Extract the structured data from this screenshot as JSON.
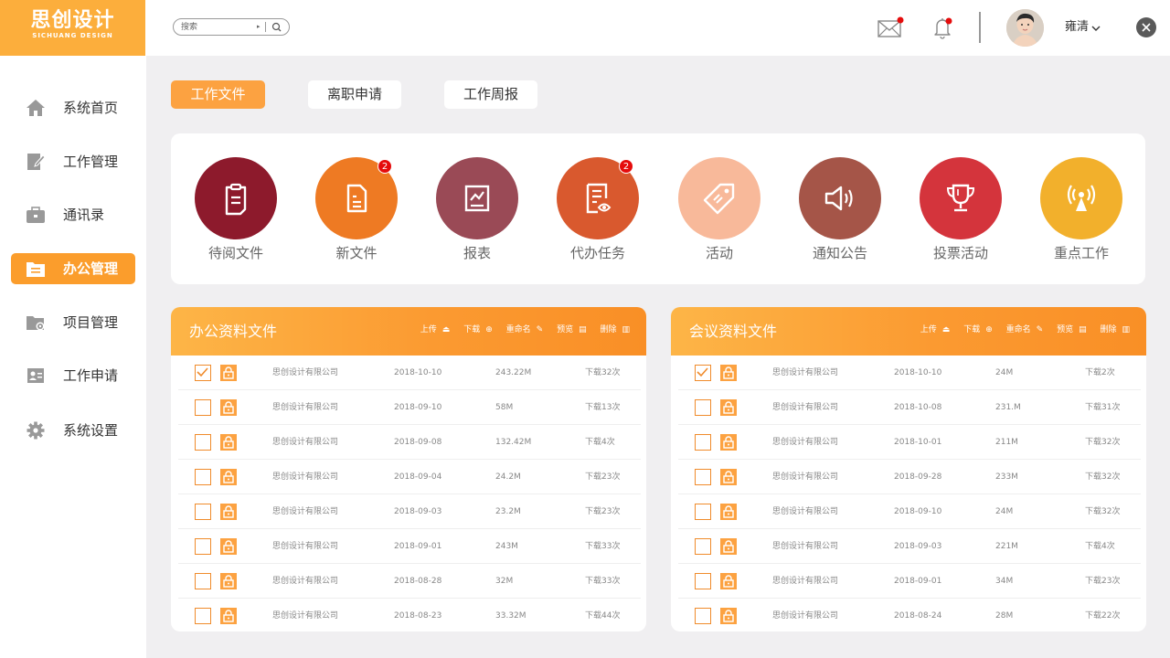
{
  "brand": {
    "name_cn": "思创设计",
    "name_en": "SICHUANG DESIGN"
  },
  "search": {
    "placeholder": "搜索"
  },
  "user": {
    "name": "雍清"
  },
  "colors": {
    "accent": "#fb9d2c",
    "brand": "#fcae3c",
    "badge": "#e50c0c"
  },
  "sidebar": {
    "items": [
      {
        "label": "系统首页",
        "icon": "home-icon"
      },
      {
        "label": "工作管理",
        "icon": "edit-document-icon"
      },
      {
        "label": "通讯录",
        "icon": "briefcase-icon"
      },
      {
        "label": "办公管理",
        "icon": "folder-icon",
        "active": true
      },
      {
        "label": "项目管理",
        "icon": "folder-settings-icon"
      },
      {
        "label": "工作申请",
        "icon": "id-card-icon"
      },
      {
        "label": "系统设置",
        "icon": "gear-icon"
      }
    ]
  },
  "tabs": [
    {
      "label": "工作文件",
      "active": true
    },
    {
      "label": "离职申请"
    },
    {
      "label": "工作周报"
    }
  ],
  "quick_actions": [
    {
      "label": "待阅文件",
      "color": "#8d1a2c",
      "icon": "clipboard-icon",
      "badge": ""
    },
    {
      "label": "新文件",
      "color": "#ee7a23",
      "icon": "new-file-icon",
      "badge": "2"
    },
    {
      "label": "报表",
      "color": "#9a4a56",
      "icon": "report-icon",
      "badge": ""
    },
    {
      "label": "代办任务",
      "color": "#d9592e",
      "icon": "task-list-icon",
      "badge": "2"
    },
    {
      "label": "活动",
      "color": "#f8b99a",
      "icon": "tag-icon",
      "badge": ""
    },
    {
      "label": "通知公告",
      "color": "#a55548",
      "icon": "speaker-icon",
      "badge": ""
    },
    {
      "label": "投票活动",
      "color": "#d4343c",
      "icon": "trophy-icon",
      "badge": ""
    },
    {
      "label": "重点工作",
      "color": "#f2b02c",
      "icon": "broadcast-icon",
      "badge": ""
    }
  ],
  "panels": [
    {
      "title": "办公资料文件",
      "actions": [
        "上传",
        "下载",
        "重命名",
        "预览",
        "删除"
      ],
      "rows": [
        {
          "checked": true,
          "company": "思创设计有限公司",
          "date": "2018-10-10",
          "size": "243.22M",
          "downloads": "下载32次"
        },
        {
          "checked": false,
          "company": "思创设计有限公司",
          "date": "2018-09-10",
          "size": "58M",
          "downloads": "下载13次"
        },
        {
          "checked": false,
          "company": "思创设计有限公司",
          "date": "2018-09-08",
          "size": "132.42M",
          "downloads": "下载4次"
        },
        {
          "checked": false,
          "company": "思创设计有限公司",
          "date": "2018-09-04",
          "size": "24.2M",
          "downloads": "下载23次"
        },
        {
          "checked": false,
          "company": "思创设计有限公司",
          "date": "2018-09-03",
          "size": "23.2M",
          "downloads": "下载23次"
        },
        {
          "checked": false,
          "company": "思创设计有限公司",
          "date": "2018-09-01",
          "size": "243M",
          "downloads": "下载33次"
        },
        {
          "checked": false,
          "company": "思创设计有限公司",
          "date": "2018-08-28",
          "size": "32M",
          "downloads": "下载33次"
        },
        {
          "checked": false,
          "company": "思创设计有限公司",
          "date": "2018-08-23",
          "size": "33.32M",
          "downloads": "下载44次"
        }
      ]
    },
    {
      "title": "会议资料文件",
      "actions": [
        "上传",
        "下载",
        "重命名",
        "预览",
        "删除"
      ],
      "rows": [
        {
          "checked": true,
          "company": "思创设计有限公司",
          "date": "2018-10-10",
          "size": "24M",
          "downloads": "下载2次"
        },
        {
          "checked": false,
          "company": "思创设计有限公司",
          "date": "2018-10-08",
          "size": "231.M",
          "downloads": "下载31次"
        },
        {
          "checked": false,
          "company": "思创设计有限公司",
          "date": "2018-10-01",
          "size": "211M",
          "downloads": "下载32次"
        },
        {
          "checked": false,
          "company": "思创设计有限公司",
          "date": "2018-09-28",
          "size": "233M",
          "downloads": "下载32次"
        },
        {
          "checked": false,
          "company": "思创设计有限公司",
          "date": "2018-09-10",
          "size": "24M",
          "downloads": "下载32次"
        },
        {
          "checked": false,
          "company": "思创设计有限公司",
          "date": "2018-09-03",
          "size": "221M",
          "downloads": "下载4次"
        },
        {
          "checked": false,
          "company": "思创设计有限公司",
          "date": "2018-09-01",
          "size": "34M",
          "downloads": "下载23次"
        },
        {
          "checked": false,
          "company": "思创设计有限公司",
          "date": "2018-08-24",
          "size": "28M",
          "downloads": "下载22次"
        }
      ]
    }
  ]
}
